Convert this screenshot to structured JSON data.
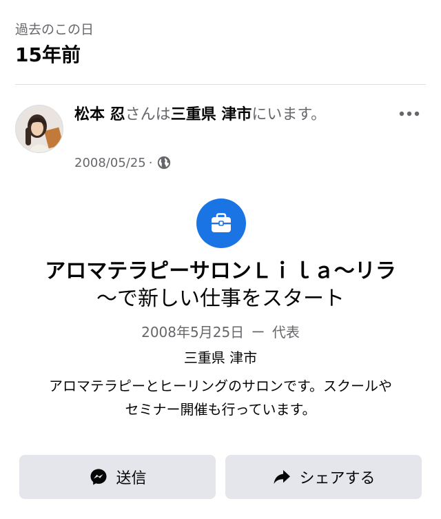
{
  "section": {
    "label": "過去のこの日",
    "years_ago": "15年前"
  },
  "post": {
    "author_name": "松本 忍",
    "status_middle": "さんは",
    "place_name": "三重県 津市",
    "status_end": "にいます。",
    "date": "2008/05/25",
    "separator": "·",
    "icons": {
      "more": "more-dots-icon",
      "privacy": "globe-icon",
      "avatar": "avatar-photo"
    }
  },
  "event": {
    "icon": "briefcase-icon",
    "title_line1": "アロマテラピーサロンＬｉｌａ〜リラ",
    "title_line2": "〜で新しい仕事をスタート",
    "date": "2008年5月25日",
    "dash": "ー",
    "role": "代表",
    "location": "三重県 津市",
    "description_line1": "アロマテラピーとヒーリングのサロンです。スクールや",
    "description_line2": "セミナー開催も行っています。"
  },
  "actions": {
    "send_label": "送信",
    "share_label": "シェアする",
    "send_icon": "messenger-icon",
    "share_icon": "share-arrow-icon"
  },
  "colors": {
    "accent": "#1b74e4",
    "secondary_text": "#65676b",
    "button_bg": "#e4e6eb",
    "divider": "#dadde1"
  }
}
